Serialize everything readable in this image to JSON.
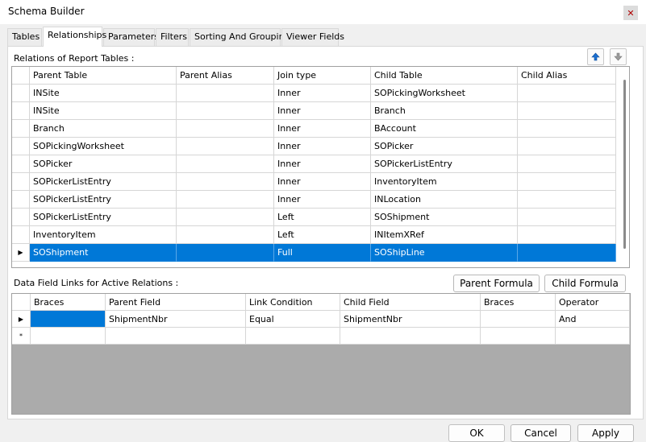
{
  "window": {
    "title": "Schema Builder"
  },
  "tabs": [
    "Tables",
    "Relationships",
    "Parameters",
    "Filters",
    "Sorting And Grouping",
    "Viewer Fields"
  ],
  "active_tab": "Relationships",
  "relations": {
    "label": "Relations of Report Tables :",
    "columns": [
      "Parent Table",
      "Parent Alias",
      "Join type",
      "Child Table",
      "Child Alias"
    ],
    "rows": [
      [
        "INSite",
        "",
        "Inner",
        "SOPickingWorksheet",
        ""
      ],
      [
        "INSite",
        "",
        "Inner",
        "Branch",
        ""
      ],
      [
        "Branch",
        "",
        "Inner",
        "BAccount",
        ""
      ],
      [
        "SOPickingWorksheet",
        "",
        "Inner",
        "SOPicker",
        ""
      ],
      [
        "SOPicker",
        "",
        "Inner",
        "SOPickerListEntry",
        ""
      ],
      [
        "SOPickerListEntry",
        "",
        "Inner",
        "InventoryItem",
        ""
      ],
      [
        "SOPickerListEntry",
        "",
        "Inner",
        "INLocation",
        ""
      ],
      [
        "SOPickerListEntry",
        "",
        "Left",
        "SOShipment",
        ""
      ],
      [
        "InventoryItem",
        "",
        "Left",
        "INItemXRef",
        ""
      ],
      [
        "SOShipment",
        "",
        "Full",
        "SOShipLine",
        ""
      ]
    ],
    "selected_row": 9
  },
  "links": {
    "label": "Data Field Links for Active Relations :",
    "parent_formula_label": "Parent Formula",
    "child_formula_label": "Child Formula",
    "columns": [
      "Braces",
      "Parent Field",
      "Link Condition",
      "Child Field",
      "Braces",
      "Operator"
    ],
    "rows": [
      [
        "",
        "ShipmentNbr",
        "Equal",
        "ShipmentNbr",
        "",
        "And"
      ]
    ],
    "new_row_marker": "*"
  },
  "buttons": {
    "ok": "OK",
    "cancel": "Cancel",
    "apply": "Apply"
  },
  "icons": {
    "close": "close-icon",
    "move_up": "arrow-up-icon",
    "move_down": "arrow-down-icon",
    "row_pointer": "row-pointer-icon"
  },
  "colors": {
    "selection": "#0078d7",
    "grid_empty": "#ababab",
    "close_x": "#b00000"
  }
}
